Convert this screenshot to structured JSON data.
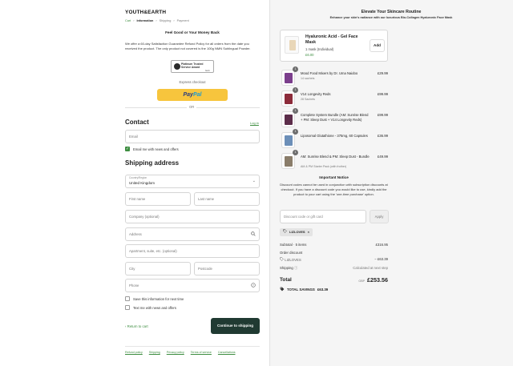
{
  "brand": {
    "logo": "YOUTH&EARTH"
  },
  "breadcrumb": [
    "Cart",
    "Information",
    "Shipping",
    "Payment"
  ],
  "guarantee": {
    "title": "Feel Good or Your Money Back",
    "text": "We offer a 60-day Satisfaction Guarantee Refund Policy for all orders from the date you received the product. The only product not covered is the 100g NMN Sublingual Powder.",
    "badge": "Platinum Trusted Service Award",
    "badge_brand": "feefo"
  },
  "express": {
    "label": "Express checkout",
    "paypal_a": "Pay",
    "paypal_b": "Pal",
    "or": "OR"
  },
  "contact": {
    "heading": "Contact",
    "login_link": "Log in",
    "email_placeholder": "Email",
    "news_label": "Email me with news and offers"
  },
  "shipping": {
    "heading": "Shipping address",
    "country_label": "Country/Region",
    "country_value": "United Kingdom",
    "first_name": "First name",
    "last_name": "Last name",
    "company": "Company (optional)",
    "address": "Address",
    "apartment": "Apartment, suite, etc. (optional)",
    "city": "City",
    "postcode": "Postcode",
    "phone": "Phone",
    "save_label": "Save this information for next time",
    "text_label": "Text me with news and offers"
  },
  "actions": {
    "return": "Return to cart",
    "continue": "Continue to shipping"
  },
  "footer": [
    "Refund policy",
    "Shipping",
    "Privacy policy",
    "Terms of service",
    "Cancellations"
  ],
  "upsell": {
    "heading": "Elevate Your Skincare Routine",
    "subheading": "Enhance your skin's radiance with our luxurious Bio-Collagen Hyaluronic Face Mask",
    "product_name": "Hyaluronic Acid - Gel Face Mask",
    "option": "1 mask (Individual)",
    "price": "£6.00",
    "add_label": "Add"
  },
  "cart_items": [
    {
      "name": "Mood Food Mixers by Dr. Uma Naidoo",
      "sub": "14 sachets",
      "price": "£29.99",
      "qty": "1",
      "color": "#7b3e8c"
    },
    {
      "name": "V14 Longevity Reds",
      "sub": "28 Sachets",
      "price": "£99.99",
      "qty": "1",
      "color": "#8c2b3a"
    },
    {
      "name": "Complete System Bundle (AM: Sunrise Blend + PM: Sleep Dust + V14 Longevity Reds)",
      "sub": "",
      "price": "£99.99",
      "qty": "1",
      "color": "#5c2d4a"
    },
    {
      "name": "Liposomal Glutathione - 375mg, 60 Capsules",
      "sub": "",
      "price": "£36.99",
      "qty": "1",
      "color": "#6c8fb8"
    },
    {
      "name": "AM: Sunrise Blend & PM: Sleep Dust - Bundle",
      "sub": "AM & PM Starter Pack (with frother)",
      "price": "£49.99",
      "qty": "1",
      "color": "#8a7d6a"
    }
  ],
  "notice": {
    "heading": "Important Notice",
    "text": "Discount codes cannot be used in conjunction with subscription discounts at checkout. If you have a discount code you would like to use, kindly add the product to your cart using the 'one-time purchase' option."
  },
  "discount": {
    "placeholder": "Discount code or gift card",
    "apply": "Apply",
    "code": "LIZLOVES",
    "remove": "×"
  },
  "summary": {
    "subtotal_label": "Subtotal · 5 items",
    "subtotal_value": "£316.95",
    "order_discount_label": "Order discount",
    "discount_code": "LIZLOVES",
    "discount_value": "− £63.39",
    "shipping_label": "Shipping",
    "shipping_value": "Calculated at next step",
    "total_label": "Total",
    "currency": "GBP",
    "total_value": "£253.56",
    "savings_label": "TOTAL SAVINGS",
    "savings_value": "£63.39"
  }
}
